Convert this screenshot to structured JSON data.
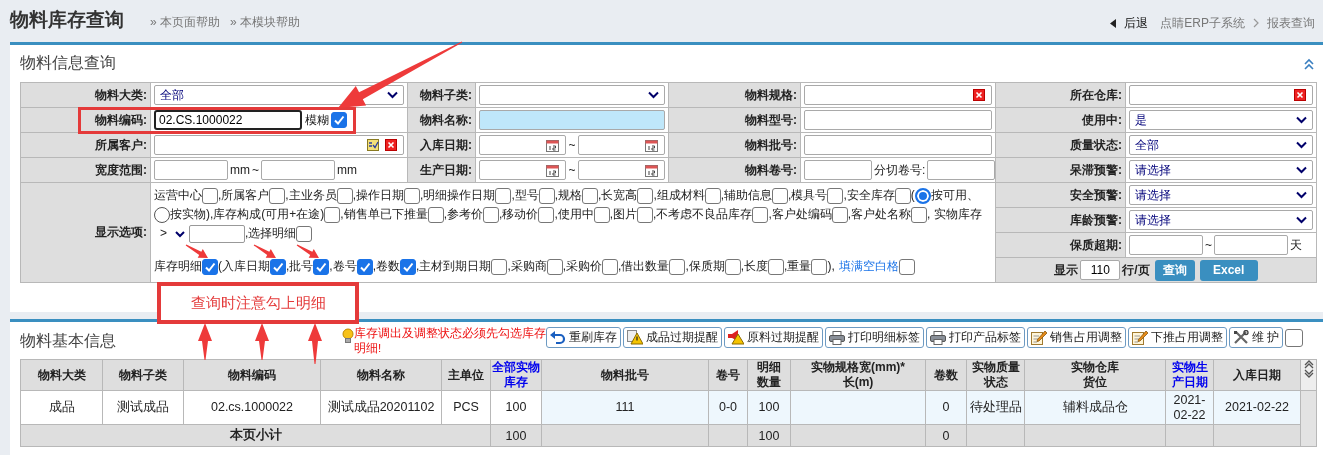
{
  "header": {
    "title": "物料库存查询",
    "help_links": [
      "» 本页面帮助",
      "» 本模块帮助"
    ],
    "back": "后退",
    "breadcrumb": [
      "点睛ERP子系统",
      "报表查询"
    ]
  },
  "query_panel": {
    "title": "物料信息查询",
    "fields": [
      {
        "label": "物料大类:",
        "kind": "select",
        "value": "全部"
      },
      {
        "label": "物料子类:",
        "kind": "select"
      },
      {
        "label": "物料规格:",
        "kind": "clear"
      },
      {
        "label": "所在仓库:",
        "kind": "clear"
      },
      {
        "label": "物料编码:",
        "kind": "code",
        "value": "02.CS.1000022",
        "fuzzy_label": "模糊",
        "fuzzy_checked": true
      },
      {
        "label": "物料名称:",
        "kind": "text",
        "highlighted": true
      },
      {
        "label": "物料型号:",
        "kind": "text",
        "highlighted": false
      },
      {
        "label": "使用中:",
        "kind": "select",
        "value": "是"
      },
      {
        "label": "所属客户:",
        "kind": "lookup"
      },
      {
        "label": "入库日期:",
        "kind": "date_range",
        "separator": "~"
      },
      {
        "label": "物料批号:",
        "kind": "text",
        "highlighted": false
      },
      {
        "label": "质量状态:",
        "kind": "select",
        "value": "全部"
      },
      {
        "label": "宽度范围:",
        "kind": "range",
        "first_unit": "mm",
        "separator": "~",
        "second_unit": "mm"
      },
      {
        "label": "生产日期:",
        "kind": "date_range",
        "separator": "~"
      },
      {
        "label": "物料卷号:",
        "kind": "roll",
        "sub_label": "分切卷号:"
      },
      {
        "label": "呆滞预警:",
        "kind": "select",
        "value": "请选择"
      }
    ],
    "options_label": "显示选项:",
    "option_lines": [
      [
        {
          "kind": "check",
          "label": "运营中心",
          "checked": false
        },
        {
          "kind": "check",
          "label": ",所属客户",
          "checked": false
        },
        {
          "kind": "check",
          "label": ",主业务员",
          "checked": false
        },
        {
          "kind": "check",
          "label": ",操作日期",
          "checked": false
        },
        {
          "kind": "check",
          "label": ",明细操作日期",
          "checked": false
        },
        {
          "kind": "check",
          "label": ",型号",
          "checked": false
        },
        {
          "kind": "check",
          "label": ",规格",
          "checked": false
        },
        {
          "kind": "check",
          "label": ",长宽高",
          "checked": false
        },
        {
          "kind": "check",
          "label": ",组成材料",
          "checked": false
        },
        {
          "kind": "check",
          "label": ",辅助信息",
          "checked": false
        },
        {
          "kind": "check",
          "label": ",模具号",
          "checked": false
        },
        {
          "kind": "check",
          "label": ",安全库存",
          "checked": false
        },
        {
          "kind": "text",
          "label": "("
        },
        {
          "kind": "radio",
          "label": "按可用、",
          "selected": true
        },
        {
          "kind": "radio",
          "label": "按实物)",
          "selected": false
        },
        {
          "kind": "check",
          "label": ",库存构成(可用+在途)",
          "checked": false
        },
        {
          "kind": "check",
          "label": ",销售单已下推量",
          "checked": false
        },
        {
          "kind": "check",
          "label": ",参考价",
          "checked": false
        },
        {
          "kind": "check",
          "label": ",移动价",
          "checked": false
        },
        {
          "kind": "check",
          "label": ",使用中",
          "checked": false
        },
        {
          "kind": "check",
          "label": ",图片",
          "checked": false
        },
        {
          "kind": "check",
          "label": ",不考虑不良品库存",
          "checked": false
        },
        {
          "kind": "check",
          "label": ",客户处编码",
          "checked": false
        },
        {
          "kind": "check",
          "label": ",客户处名称",
          "checked": false
        },
        {
          "kind": "text",
          "label": ", 实物库存"
        },
        {
          "kind": "select",
          "value": ">"
        },
        {
          "kind": "input"
        },
        {
          "kind": "check",
          "label": ",选择明细",
          "checked": false
        }
      ],
      [
        {
          "kind": "check",
          "label": "库存明细",
          "checked": true,
          "pointed": true
        },
        {
          "kind": "check",
          "label": "(入库日期",
          "checked": true,
          "pointed": true
        },
        {
          "kind": "check",
          "label": ",批号",
          "checked": true,
          "pointed": true
        },
        {
          "kind": "check",
          "label": ",卷号",
          "checked": true
        },
        {
          "kind": "check",
          "label": ",卷数",
          "checked": true
        },
        {
          "kind": "check",
          "label": ",主材到期日期",
          "checked": false
        },
        {
          "kind": "check",
          "label": ",采购商",
          "checked": false
        },
        {
          "kind": "check",
          "label": ",采购价",
          "checked": false
        },
        {
          "kind": "check",
          "label": ",借出数量",
          "checked": false
        },
        {
          "kind": "check",
          "label": ",保质期",
          "checked": false
        },
        {
          "kind": "check",
          "label": ",长度",
          "checked": false
        },
        {
          "kind": "check",
          "label": ",重量",
          "checked": false
        },
        {
          "kind": "text",
          "label": "),"
        },
        {
          "kind": "link_check",
          "label": "填满空白格",
          "checked": false
        }
      ]
    ],
    "side_fields": [
      {
        "label": "安全预警:",
        "kind": "select",
        "value": "请选择"
      },
      {
        "label": "库龄预警:",
        "kind": "select",
        "value": "请选择"
      },
      {
        "label": "保质超期:",
        "kind": "range",
        "separator": "~",
        "second_unit": "天"
      }
    ],
    "pager": {
      "label": "显示",
      "page_size": "110",
      "unit": "行/页",
      "buttons": [
        "查询",
        "Excel"
      ]
    }
  },
  "annotation": {
    "note": "查询时注意勾上明细"
  },
  "result_panel": {
    "title": "物料基本信息",
    "notice": "库存调出及调整状态必须先勾选库存明细!",
    "toolbar": [
      {
        "kind": "refresh",
        "label": "重刷库存"
      },
      {
        "kind": "warning",
        "label": "成品过期提醒"
      },
      {
        "kind": "megaphone",
        "label": "原料过期提醒"
      },
      {
        "kind": "print",
        "label": "打印明细标签"
      },
      {
        "kind": "print",
        "label": "打印产品标签"
      },
      {
        "kind": "edit",
        "label": "销售占用调整"
      },
      {
        "kind": "edit",
        "label": "下推占用调整"
      },
      {
        "kind": "tools",
        "label": "维 护"
      }
    ],
    "maintain_checked": false,
    "columns": [
      {
        "label": "物料大类",
        "emphasis": false
      },
      {
        "label": "物料子类",
        "emphasis": false
      },
      {
        "label": "物料编码",
        "emphasis": false
      },
      {
        "label": "物料名称",
        "emphasis": false
      },
      {
        "label": "主单位",
        "emphasis": false
      },
      {
        "label": "全部实物库存",
        "emphasis": true
      },
      {
        "label": "物料批号",
        "emphasis": false
      },
      {
        "label": "卷号",
        "emphasis": false
      },
      {
        "label": "明细数量",
        "emphasis": false
      },
      {
        "label": "实物规格宽(mm)*长(m)",
        "emphasis": false
      },
      {
        "label": "卷数",
        "emphasis": false
      },
      {
        "label": "实物质量状态",
        "emphasis": false
      },
      {
        "label": "实物仓库货位",
        "emphasis": false
      },
      {
        "label": "实物生产日期",
        "emphasis": true
      },
      {
        "label": "入库日期",
        "emphasis": false
      }
    ],
    "rows": [
      {
        "cells": [
          "成品",
          "测试成品",
          "02.cs.1000022",
          "测试成品20201102",
          "PCS",
          "100",
          "111",
          "0-0",
          "100",
          null,
          "0",
          "待处理品",
          "辅料成品仓",
          "2021-\n02-22",
          "2021-02-22"
        ]
      }
    ],
    "subtotal": {
      "label": "本页小计",
      "cells": [
        "100",
        null,
        null,
        "100",
        null,
        "0",
        null,
        null,
        null,
        null
      ]
    }
  }
}
